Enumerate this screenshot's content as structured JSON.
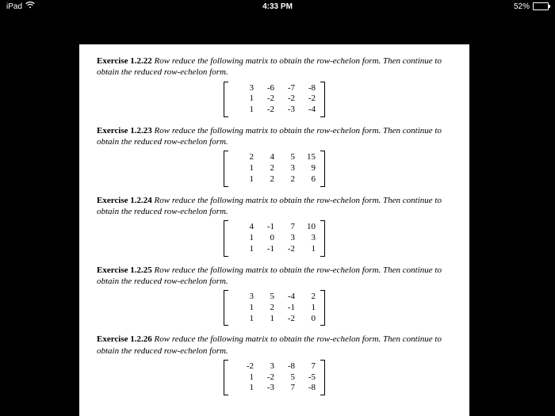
{
  "status": {
    "device": "iPad",
    "time": "4:33 PM",
    "battery_pct": "52%",
    "battery_fill_pct": 52
  },
  "instruction": "Row reduce the following matrix to obtain the row-echelon form. Then continue to obtain the reduced row-echelon form.",
  "exercises": [
    {
      "num": "Exercise 1.2.22",
      "matrix": [
        [
          3,
          -6,
          -7,
          -8
        ],
        [
          1,
          -2,
          -2,
          -2
        ],
        [
          1,
          -2,
          -3,
          -4
        ]
      ]
    },
    {
      "num": "Exercise 1.2.23",
      "matrix": [
        [
          2,
          4,
          5,
          15
        ],
        [
          1,
          2,
          3,
          9
        ],
        [
          1,
          2,
          2,
          6
        ]
      ]
    },
    {
      "num": "Exercise 1.2.24",
      "matrix": [
        [
          4,
          -1,
          7,
          10
        ],
        [
          1,
          0,
          3,
          3
        ],
        [
          1,
          -1,
          -2,
          1
        ]
      ]
    },
    {
      "num": "Exercise 1.2.25",
      "matrix": [
        [
          3,
          5,
          -4,
          2
        ],
        [
          1,
          2,
          -1,
          1
        ],
        [
          1,
          1,
          -2,
          0
        ]
      ]
    },
    {
      "num": "Exercise 1.2.26",
      "matrix": [
        [
          -2,
          3,
          -8,
          7
        ],
        [
          1,
          -2,
          5,
          -5
        ],
        [
          1,
          -3,
          7,
          -8
        ]
      ]
    }
  ],
  "chart_data": {
    "type": "table",
    "title": "Matrices for row-reduction exercises 1.2.22–1.2.26",
    "series": [
      {
        "name": "1.2.22",
        "values": [
          [
            3,
            -6,
            -7,
            -8
          ],
          [
            1,
            -2,
            -2,
            -2
          ],
          [
            1,
            -2,
            -3,
            -4
          ]
        ]
      },
      {
        "name": "1.2.23",
        "values": [
          [
            2,
            4,
            5,
            15
          ],
          [
            1,
            2,
            3,
            9
          ],
          [
            1,
            2,
            2,
            6
          ]
        ]
      },
      {
        "name": "1.2.24",
        "values": [
          [
            4,
            -1,
            7,
            10
          ],
          [
            1,
            0,
            3,
            3
          ],
          [
            1,
            -1,
            -2,
            1
          ]
        ]
      },
      {
        "name": "1.2.25",
        "values": [
          [
            3,
            5,
            -4,
            2
          ],
          [
            1,
            2,
            -1,
            1
          ],
          [
            1,
            1,
            -2,
            0
          ]
        ]
      },
      {
        "name": "1.2.26",
        "values": [
          [
            -2,
            3,
            -8,
            7
          ],
          [
            1,
            -2,
            5,
            -5
          ],
          [
            1,
            -3,
            7,
            -8
          ]
        ]
      }
    ]
  }
}
